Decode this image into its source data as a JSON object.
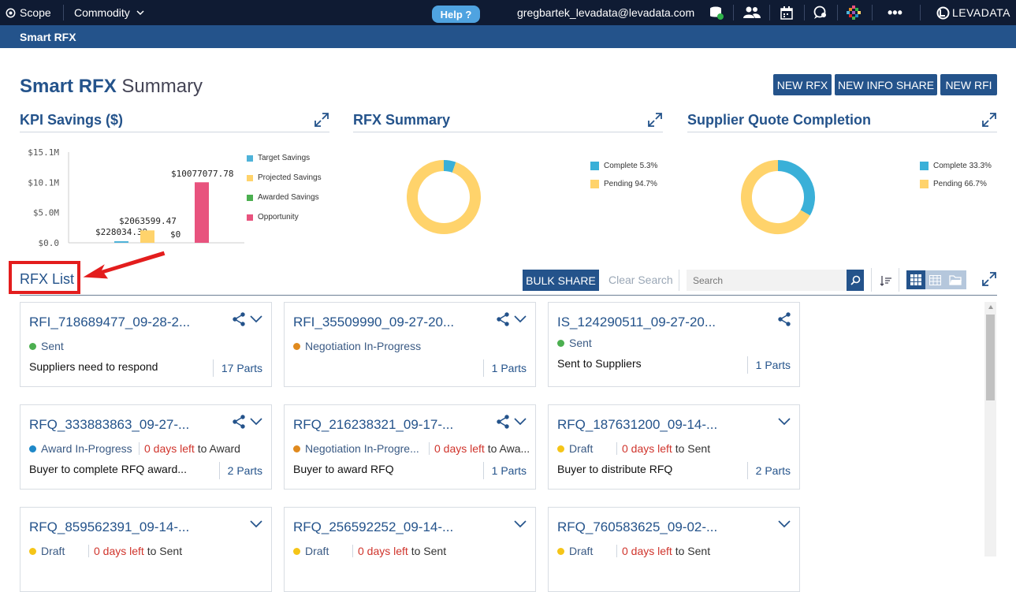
{
  "topbar": {
    "scope_label": "Scope",
    "commodity_label": "Commodity",
    "help_label": "Help ?",
    "user_email": "gregbartek_levadata@levadata.com",
    "brand": "LEVADATA"
  },
  "subbar": {
    "title": "Smart RFX"
  },
  "page": {
    "title_bold": "Smart RFX",
    "title_rest": "Summary",
    "buttons": [
      "NEW RFX",
      "NEW INFO SHARE",
      "NEW RFI"
    ]
  },
  "panels": {
    "kpi": {
      "title": "KPI Savings ($)",
      "chart_data": {
        "type": "bar",
        "categories": [
          "Target Savings",
          "Projected Savings",
          "Awarded Savings",
          "Opportunity"
        ],
        "values": [
          228034.39,
          2063599.47,
          0,
          10077077.78
        ],
        "value_labels": [
          "$228034.39",
          "$2063599.47",
          "$0",
          "$10077077.78"
        ],
        "y_ticks": [
          "$15.1M",
          "$10.1M",
          "$5.0M",
          "$0.0"
        ],
        "ylim": [
          0,
          15100000
        ],
        "colors": [
          "#4fb3d9",
          "#ffd36b",
          "#4caf50",
          "#e8537e"
        ],
        "legend": [
          "Target Savings",
          "Projected Savings",
          "Awarded Savings",
          "Opportunity"
        ]
      }
    },
    "rfx_summary": {
      "title": "RFX Summary",
      "chart_data": {
        "type": "pie",
        "labels": [
          "Complete",
          "Pending"
        ],
        "values": [
          5.3,
          94.7
        ],
        "legend": [
          "Complete 5.3%",
          "Pending 94.7%"
        ],
        "colors": [
          "#3ab0d8",
          "#ffd36b"
        ]
      }
    },
    "supplier_quote": {
      "title": "Supplier Quote Completion",
      "chart_data": {
        "type": "pie",
        "labels": [
          "Complete",
          "Pending"
        ],
        "values": [
          33.3,
          66.7
        ],
        "legend": [
          "Complete 33.3%",
          "Pending 66.7%"
        ],
        "colors": [
          "#3ab0d8",
          "#ffd36b"
        ]
      }
    }
  },
  "list": {
    "title": "RFX List",
    "bulk_share": "BULK SHARE",
    "clear_search": "Clear Search",
    "search_placeholder": "Search"
  },
  "cards": [
    {
      "title": "RFI_718689477_09-28-2...",
      "status": "Sent",
      "status_color": "#4caf50",
      "days_left": "",
      "days_to": "",
      "desc": "Suppliers need to respond",
      "parts": "17 Parts",
      "share": true,
      "chevron": true
    },
    {
      "title": "RFI_35509990_09-27-20...",
      "status": "Negotiation In-Progress",
      "status_color": "#e08a1e",
      "days_left": "",
      "days_to": "",
      "desc": "",
      "parts": "1 Parts",
      "share": true,
      "chevron": true
    },
    {
      "title": "IS_124290511_09-27-20...",
      "status": "Sent",
      "status_color": "#4caf50",
      "days_left": "",
      "days_to": "",
      "desc": "Sent to Suppliers",
      "parts": "1 Parts",
      "share": true,
      "chevron": false
    },
    {
      "title": "RFQ_333883863_09-27-...",
      "status": "Award In-Progress",
      "status_color": "#1e88c8",
      "days_left": "0 days left",
      "days_to": " to Award",
      "desc": "Buyer to complete RFQ award...",
      "parts": "2 Parts",
      "share": true,
      "chevron": true
    },
    {
      "title": "RFQ_216238321_09-17-...",
      "status": "Negotiation In-Progre...",
      "status_color": "#e08a1e",
      "days_left": "0 days left",
      "days_to": " to Awa...",
      "desc": "Buyer to award RFQ",
      "parts": "1 Parts",
      "share": true,
      "chevron": true
    },
    {
      "title": "RFQ_187631200_09-14-...",
      "status": "Draft",
      "status_color": "#f5c518",
      "days_left": "0 days left",
      "days_to": " to Sent",
      "desc": "Buyer to distribute RFQ",
      "parts": "2 Parts",
      "share": false,
      "chevron": true
    },
    {
      "title": "RFQ_859562391_09-14-...",
      "status": "Draft",
      "status_color": "#f5c518",
      "days_left": "0 days left",
      "days_to": " to Sent",
      "desc": "",
      "parts": "",
      "share": false,
      "chevron": true
    },
    {
      "title": "RFQ_256592252_09-14-...",
      "status": "Draft",
      "status_color": "#f5c518",
      "days_left": "0 days left",
      "days_to": " to Sent",
      "desc": "",
      "parts": "",
      "share": false,
      "chevron": true
    },
    {
      "title": "RFQ_760583625_09-02-...",
      "status": "Draft",
      "status_color": "#f5c518",
      "days_left": "0 days left",
      "days_to": " to Sent",
      "desc": "",
      "parts": "",
      "share": false,
      "chevron": true
    }
  ]
}
